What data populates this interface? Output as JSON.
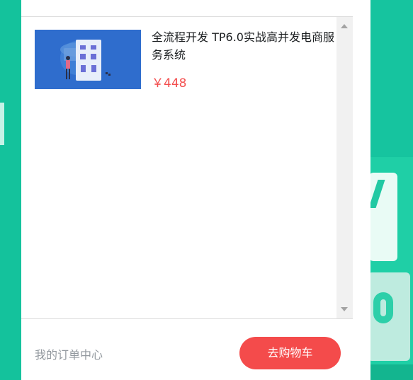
{
  "cart": {
    "items": [
      {
        "title": "全流程开发 TP6.0实战高并发电商服务系统",
        "price": "￥448",
        "thumbnail_icon": "course-thumbnail-image"
      }
    ]
  },
  "footer": {
    "order_center_label": "我的订单中心",
    "go_to_cart_label": "去购物车"
  },
  "colors": {
    "background": "#18c4a0",
    "button": "#f44b4b",
    "price": "#f01414"
  }
}
